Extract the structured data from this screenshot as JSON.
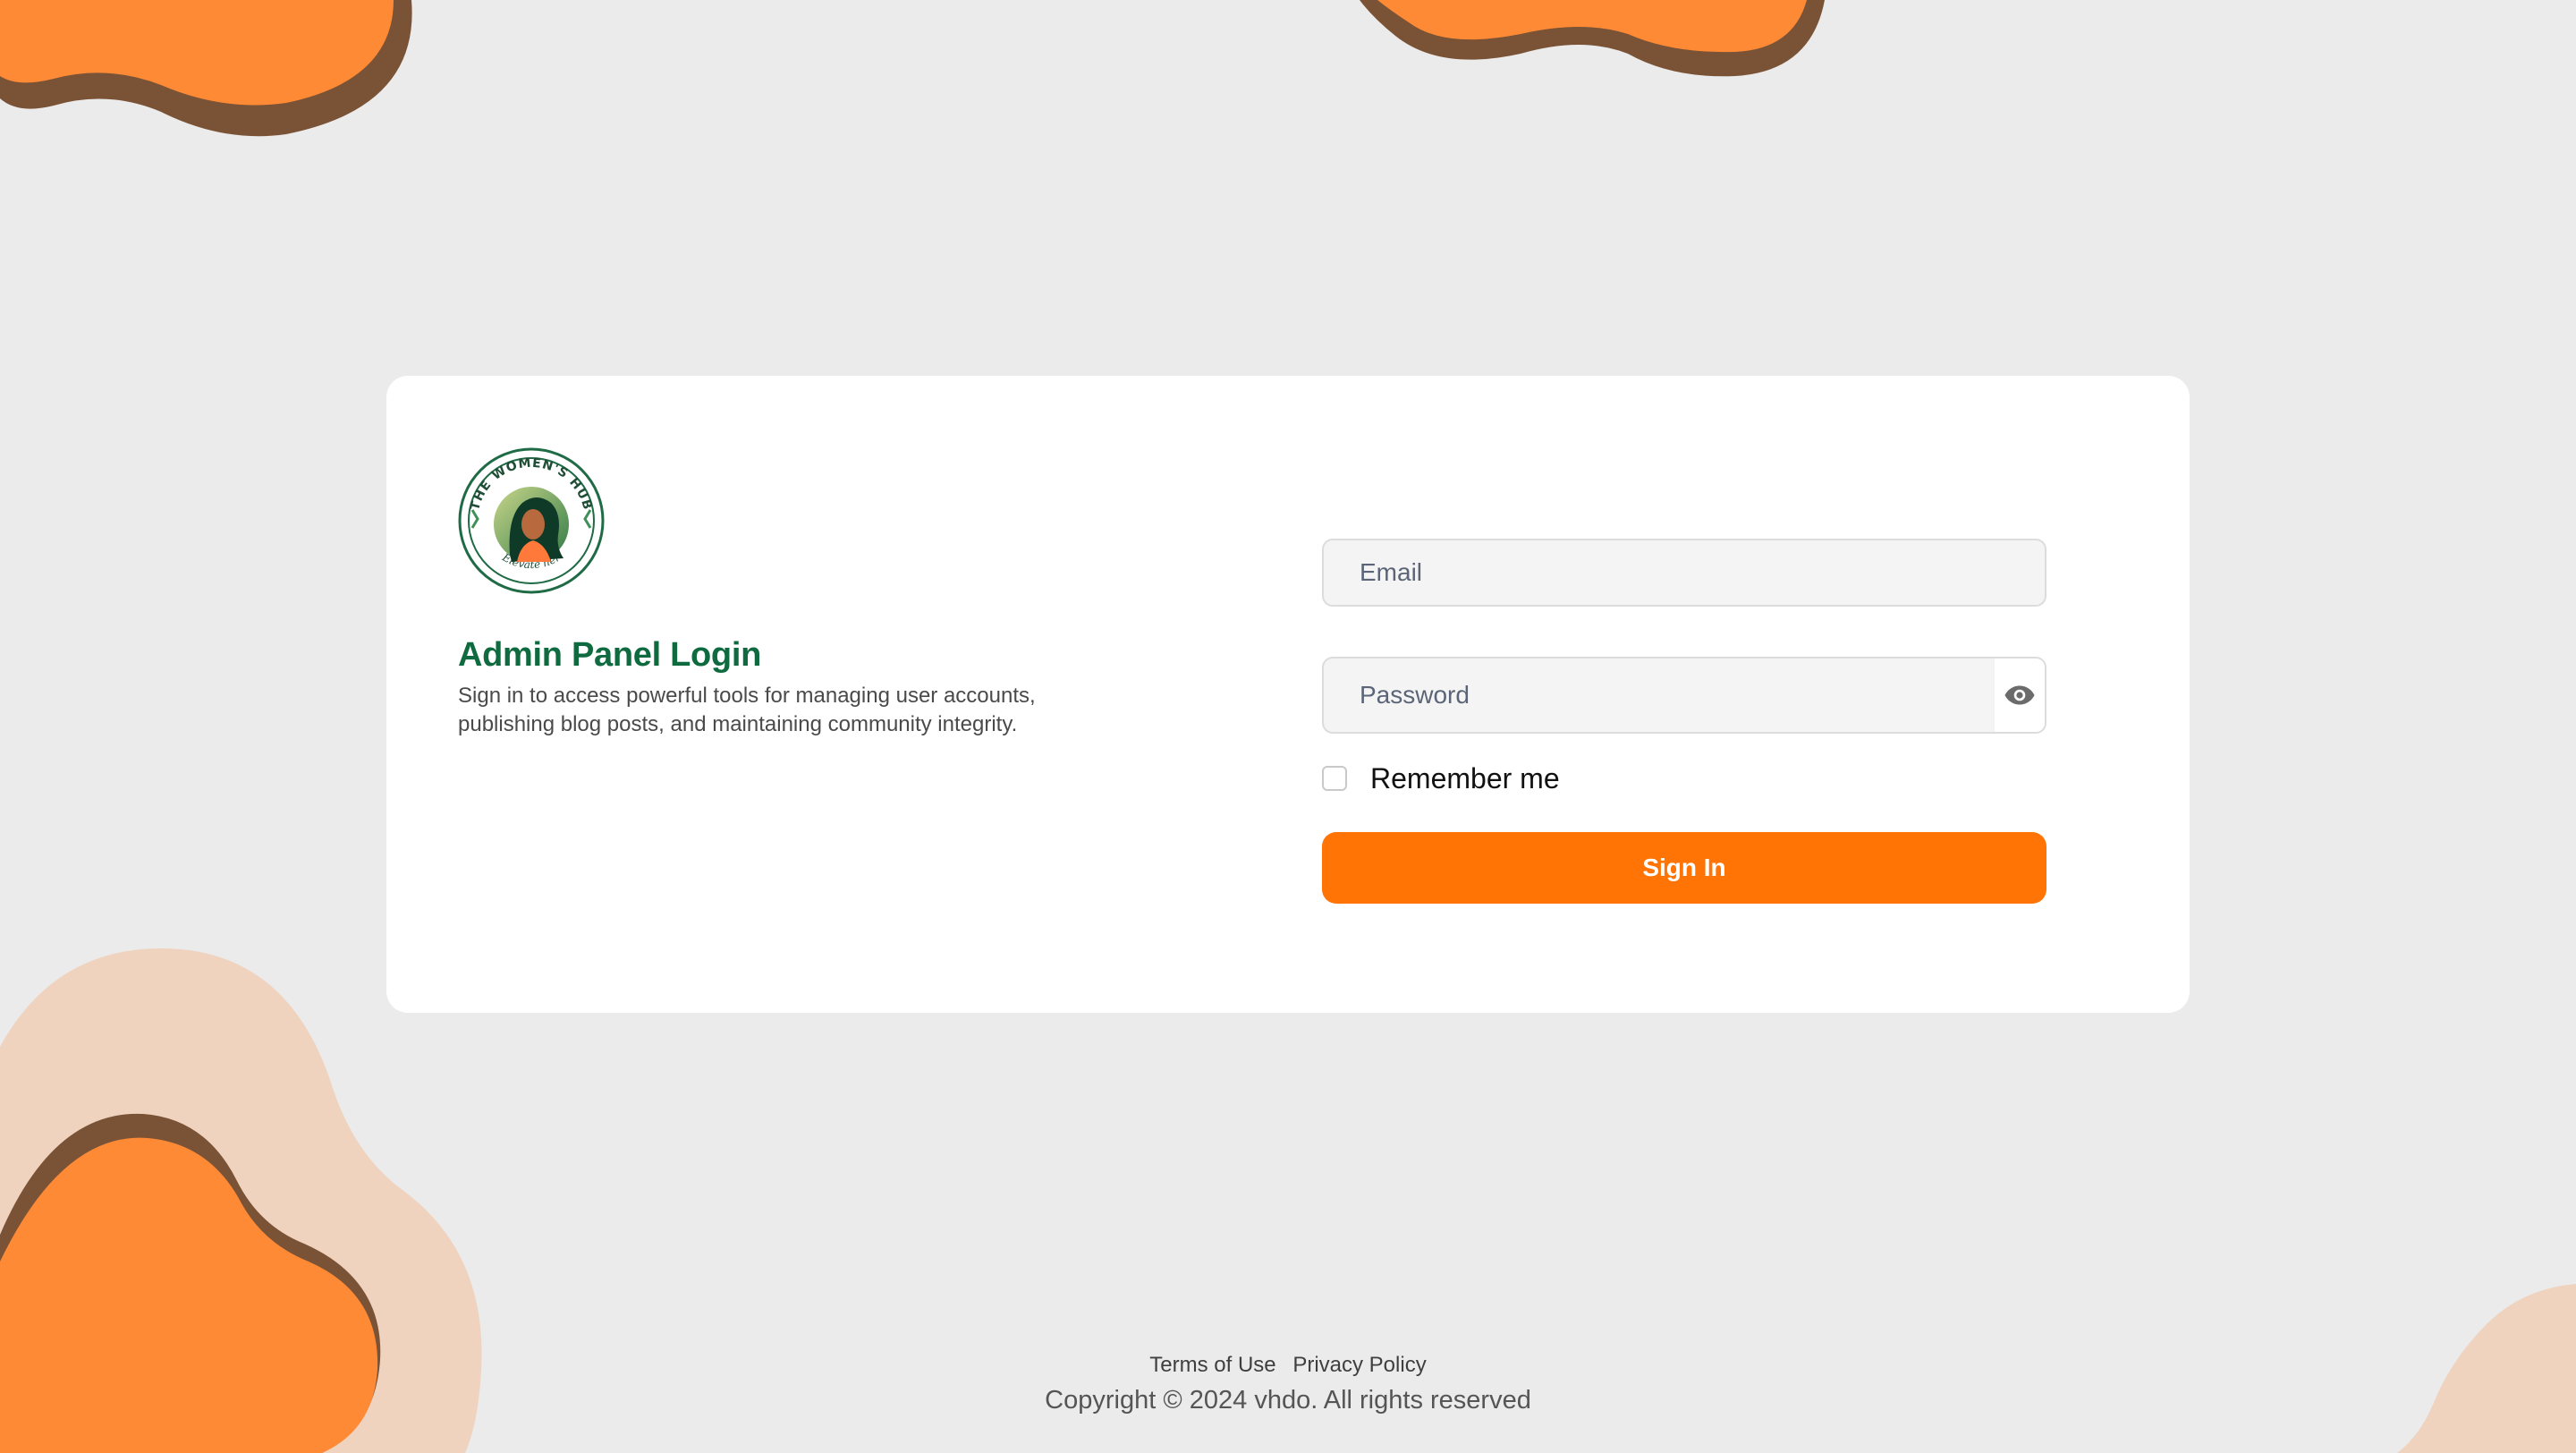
{
  "brand": {
    "logo_text_top": "THE WOMEN'S HUB",
    "logo_text_bottom": "Elevate her",
    "title": "Admin Panel Login",
    "subtitle": "Sign in to access powerful tools for managing user accounts, publishing blog posts, and maintaining community integrity."
  },
  "form": {
    "email_placeholder": "Email",
    "password_placeholder": "Password",
    "show_password_icon": "eye-icon",
    "remember_label": "Remember me",
    "remember_checked": false,
    "submit_label": "Sign In"
  },
  "footer": {
    "links": [
      "Terms of Use",
      "Privacy Policy"
    ],
    "copyright": "Copyright © 2024 vhdo. All rights reserved"
  },
  "colors": {
    "background": "#ebebeb",
    "accent": "#ff7404",
    "title": "#0f6b3f",
    "blob_orange": "#ff8a35",
    "blob_peach": "#efd3bf",
    "blob_shadow": "#7a5336"
  }
}
